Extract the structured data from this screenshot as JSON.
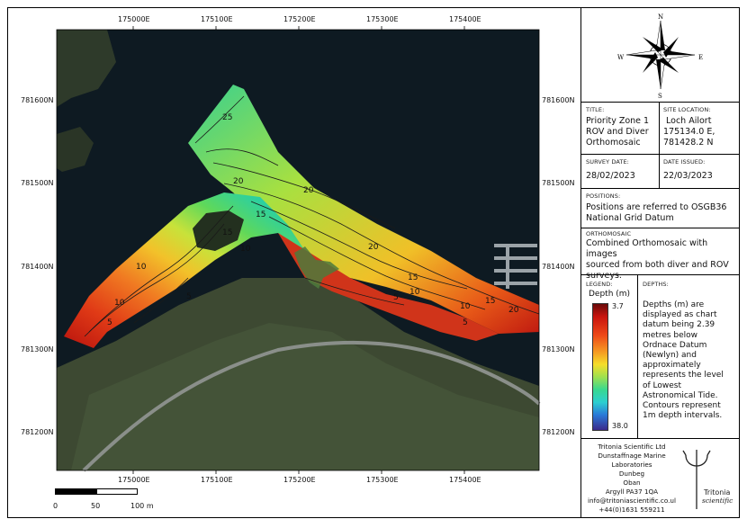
{
  "map": {
    "top_coords": [
      "175000E",
      "175100E",
      "175200E",
      "175300E",
      "175400E"
    ],
    "bottom_coords": [
      "175000E",
      "175100E",
      "175200E",
      "175300E",
      "175400E"
    ],
    "left_coords": [
      "781600N",
      "781500N",
      "781400N",
      "781300N",
      "781200N"
    ],
    "right_coords": [
      "781600N",
      "781500N",
      "781400N",
      "781300N",
      "781200N"
    ],
    "contour_labels": [
      "25",
      "20",
      "20",
      "15",
      "20",
      "15",
      "10",
      "10",
      "15",
      "10",
      "5",
      "10",
      "5",
      "5",
      "15",
      "10",
      "5",
      "20"
    ],
    "scale": {
      "ticks": [
        "0",
        "50",
        "100 m"
      ]
    }
  },
  "panel": {
    "compass": {
      "n": "N",
      "s": "S",
      "e": "E",
      "w": "W"
    },
    "title_label": "TITLE:",
    "title_value": [
      "Priority Zone 1",
      "ROV and Diver",
      "Orthomosaic"
    ],
    "site_label": "SITE LOCATION:",
    "site_value": [
      "Loch Ailort",
      "175134.0 E,",
      "781428.2 N"
    ],
    "survey_date_label": "SURVEY DATE:",
    "survey_date": "28/02/2023",
    "date_issued_label": "DATE ISSUED:",
    "date_issued": "22/03/2023",
    "positions_label": "POSITIONS:",
    "positions_value": [
      "Positions are referred to OSGB36",
      "National Grid Datum"
    ],
    "ortho_label": "ORTHOMOSAIC",
    "ortho_value": [
      "Combined Orthomosaic with images",
      "sourced from both diver and ROV",
      "surveys."
    ],
    "legend_label": "LEGEND:",
    "legend_title": "Depth (m)",
    "legend_min": "3.7",
    "legend_max": "38.0",
    "depths_label": "DEPTHS:",
    "depths_value": [
      "Depths (m) are",
      "displayed as chart",
      "datum being 2.39",
      "metres below",
      "Ordnace Datum",
      "(Newlyn) and",
      "approximately",
      "represents the level",
      "of Lowest",
      "Astronomical Tide.",
      "Contours represent",
      "1m depth intervals."
    ],
    "company": [
      "Tritonia Scientific Ltd",
      "Dunstaffnage Marine",
      "Laboratories",
      "Dunbeg",
      "Oban",
      "Argyll PA37 1QA",
      "info@tritoniascientific.co.ul",
      "+44(0)1631 559211"
    ],
    "logo_text": [
      "Tritonia",
      "scientific"
    ]
  },
  "colors": {
    "sea": "#0e1a22",
    "land": "#3a4631",
    "shallow": "#c51a10",
    "mid": "#f0a020",
    "deep": "#2fd48a",
    "deepest": "#3a2a8c"
  }
}
